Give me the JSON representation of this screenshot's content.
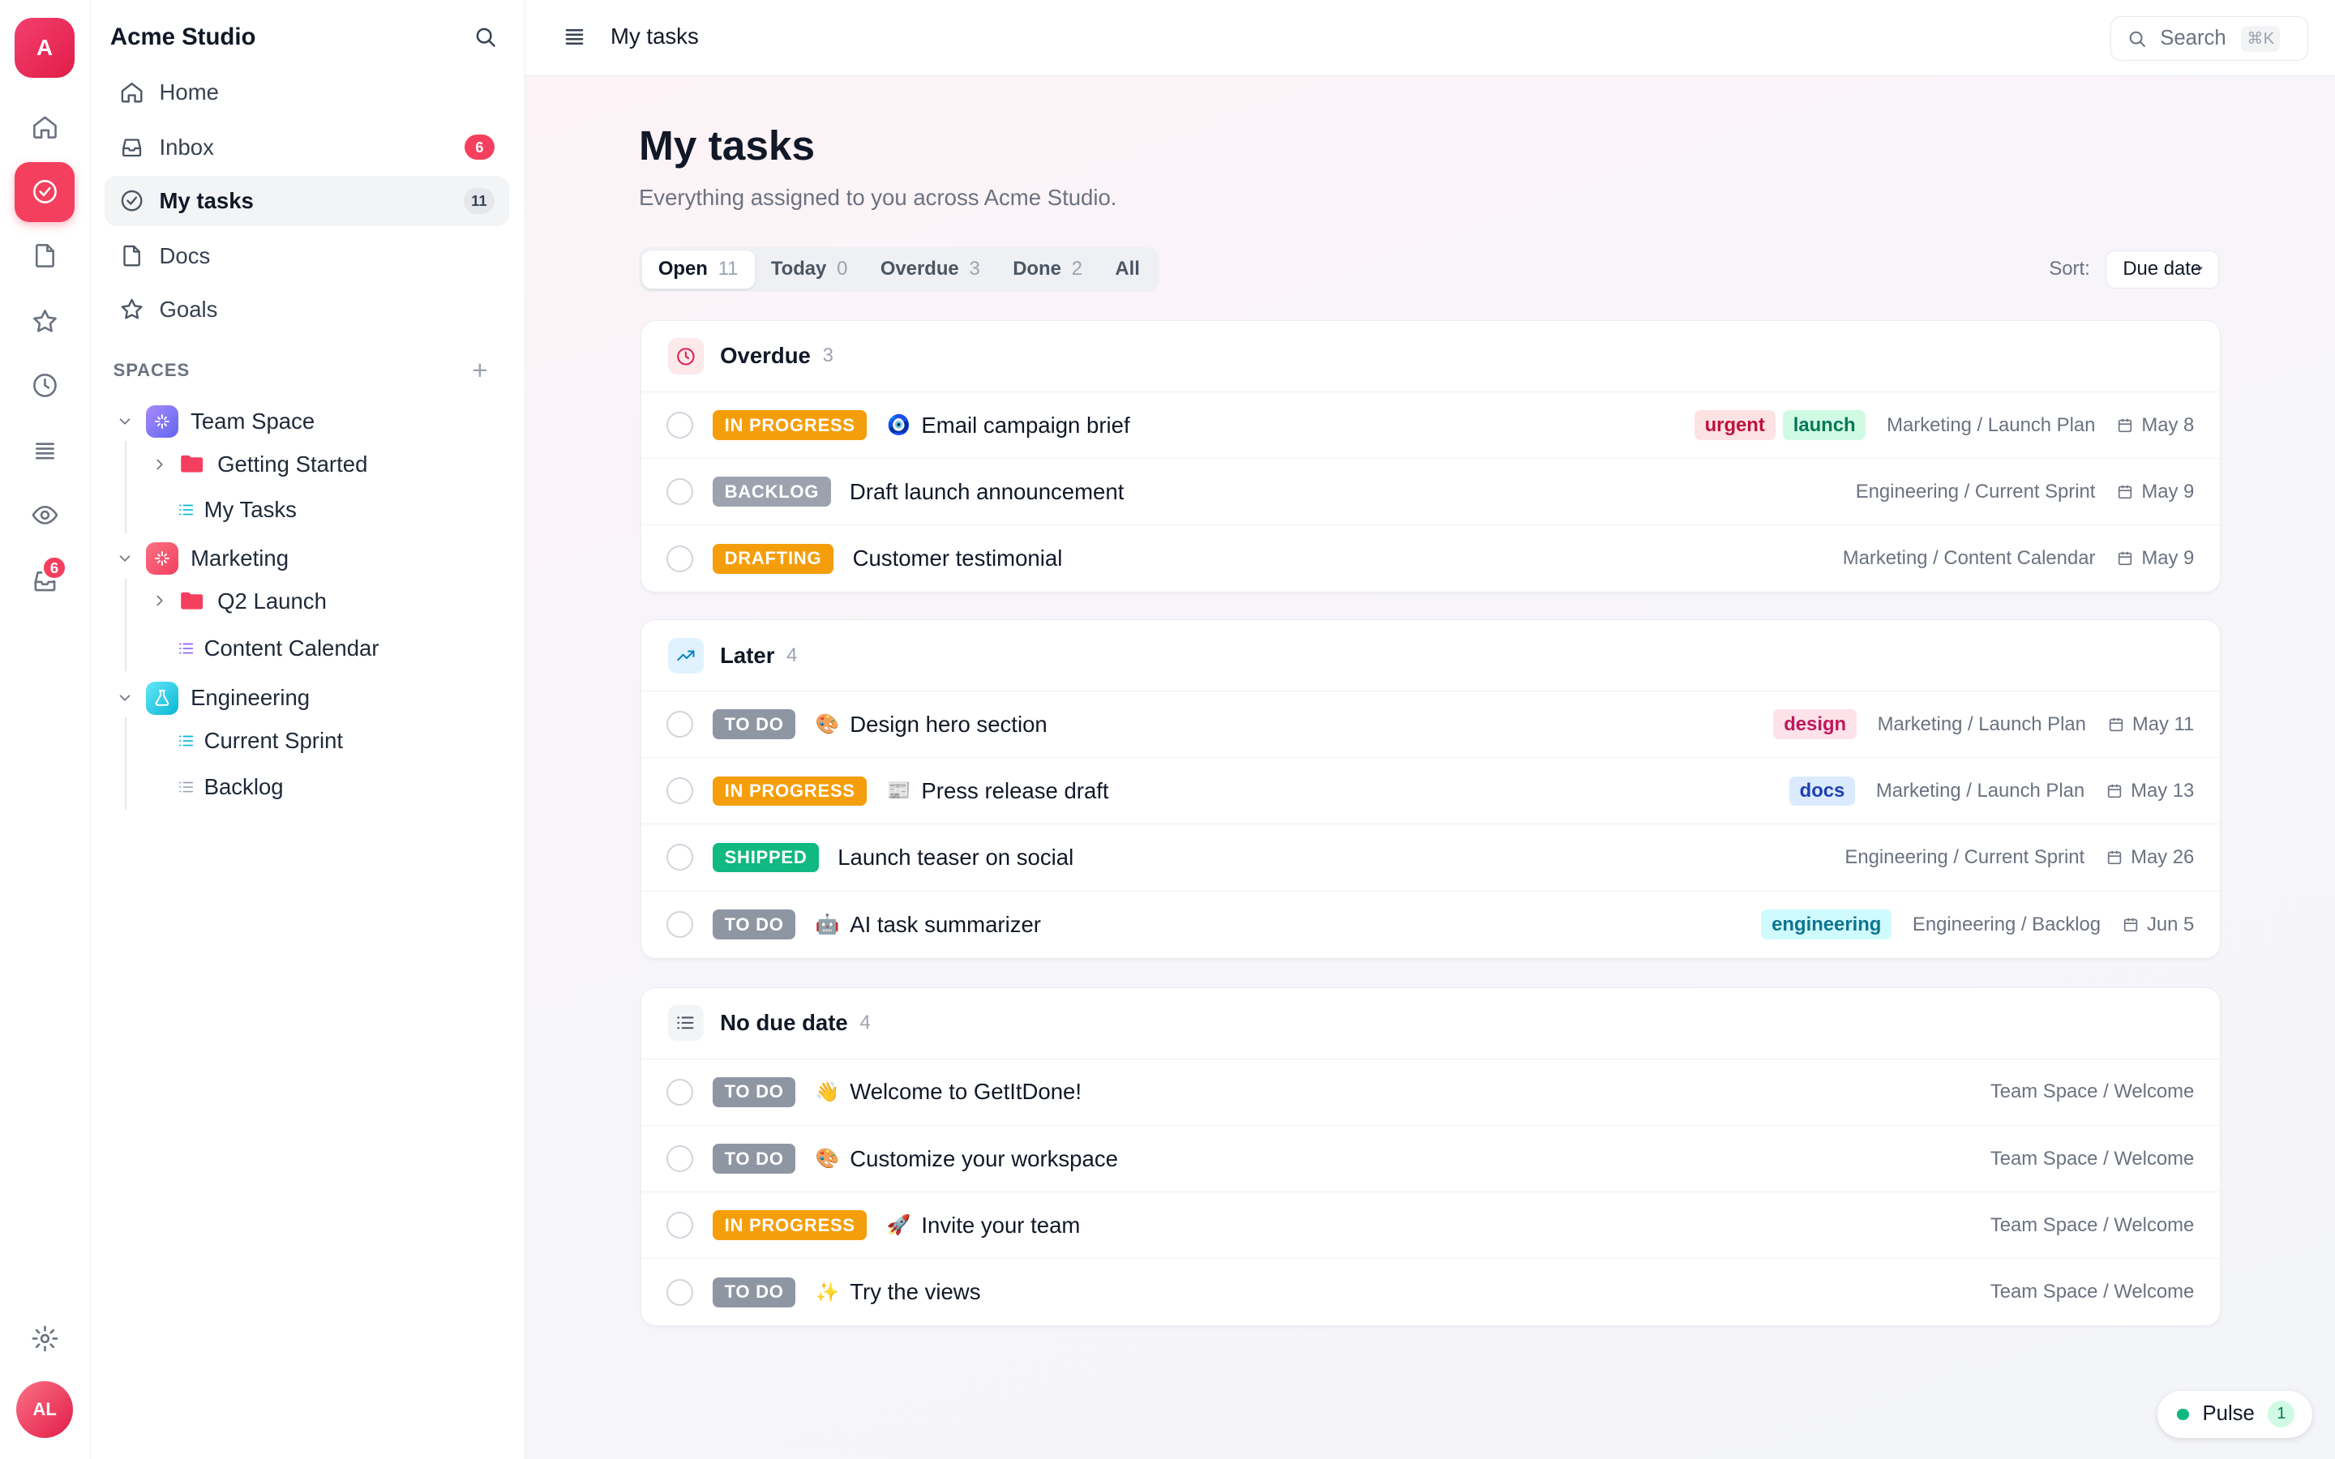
{
  "workspace": {
    "initial": "A",
    "name": "Acme Studio"
  },
  "user": {
    "initials": "AL"
  },
  "rail": {
    "inbox_badge": "6"
  },
  "nav": [
    {
      "label": "Home",
      "icon": "home-icon"
    },
    {
      "label": "Inbox",
      "icon": "inbox-icon",
      "badge": "6"
    },
    {
      "label": "My tasks",
      "icon": "check-circle-icon",
      "badge": "11",
      "active": true
    },
    {
      "label": "Docs",
      "icon": "doc-icon"
    },
    {
      "label": "Goals",
      "icon": "star-icon"
    }
  ],
  "spaces": {
    "heading": "SPACES",
    "team_space": {
      "label": "Team Space",
      "color": "#8b5cf6",
      "children": [
        "Getting Started",
        "My Tasks"
      ]
    },
    "marketing": {
      "label": "Marketing",
      "color": "#f43f5e",
      "children": [
        "Q2 Launch",
        "Content Calendar"
      ]
    },
    "engineering": {
      "label": "Engineering",
      "color": "#22d3ee",
      "children": [
        "Current Sprint",
        "Backlog"
      ]
    }
  },
  "topbar": {
    "title": "My tasks",
    "search_label": "Search",
    "search_kbd": "⌘K"
  },
  "page": {
    "title": "My tasks",
    "subtitle": "Everything assigned to you across Acme Studio."
  },
  "tabs": [
    {
      "label": "Open",
      "count": "11",
      "active": true
    },
    {
      "label": "Today",
      "count": "0"
    },
    {
      "label": "Overdue",
      "count": "3"
    },
    {
      "label": "Done",
      "count": "2"
    },
    {
      "label": "All",
      "count": ""
    }
  ],
  "sort": {
    "label": "Sort:",
    "value": "Due date"
  },
  "status_colors": {
    "IN PROGRESS": "#f59e0b",
    "BACKLOG": "#9ca3af",
    "DRAFTING": "#f59e0b",
    "TO DO": "#8f96a3",
    "SHIPPED": "#10b981"
  },
  "groups": {
    "overdue": {
      "title": "Overdue",
      "count": "3",
      "tasks": [
        {
          "status": "IN PROGRESS",
          "emoji": "🧿",
          "name": "Email campaign brief",
          "tags": [
            "urgent",
            "launch"
          ],
          "path": "Marketing / Launch Plan",
          "due": "May 8"
        },
        {
          "status": "BACKLOG",
          "emoji": "",
          "name": "Draft launch announcement",
          "tags": [],
          "path": "Engineering / Current Sprint",
          "due": "May 9"
        },
        {
          "status": "DRAFTING",
          "emoji": "",
          "name": "Customer testimonial",
          "tags": [],
          "path": "Marketing / Content Calendar",
          "due": "May 9"
        }
      ]
    },
    "later": {
      "title": "Later",
      "count": "4",
      "tasks": [
        {
          "status": "TO DO",
          "emoji": "🎨",
          "name": "Design hero section",
          "tags": [
            "design"
          ],
          "path": "Marketing / Launch Plan",
          "due": "May 11"
        },
        {
          "status": "IN PROGRESS",
          "emoji": "📰",
          "name": "Press release draft",
          "tags": [
            "docs"
          ],
          "path": "Marketing / Launch Plan",
          "due": "May 13"
        },
        {
          "status": "SHIPPED",
          "emoji": "",
          "name": "Launch teaser on social",
          "tags": [],
          "path": "Engineering / Current Sprint",
          "due": "May 26"
        },
        {
          "status": "TO DO",
          "emoji": "🤖",
          "name": "AI task summarizer",
          "tags": [
            "engineering"
          ],
          "path": "Engineering / Backlog",
          "due": "Jun 5"
        }
      ]
    },
    "nodue": {
      "title": "No due date",
      "count": "4",
      "tasks": [
        {
          "status": "TO DO",
          "emoji": "👋",
          "name": "Welcome to GetItDone!",
          "tags": [],
          "path": "Team Space / Welcome",
          "due": ""
        },
        {
          "status": "TO DO",
          "emoji": "🎨",
          "name": "Customize your workspace",
          "tags": [],
          "path": "Team Space / Welcome",
          "due": ""
        },
        {
          "status": "IN PROGRESS",
          "emoji": "🚀",
          "name": "Invite your team",
          "tags": [],
          "path": "Team Space / Welcome",
          "due": ""
        },
        {
          "status": "TO DO",
          "emoji": "✨",
          "name": "Try the views",
          "tags": [],
          "path": "Team Space / Welcome",
          "due": ""
        }
      ]
    }
  },
  "tag_colors": {
    "urgent": {
      "bg": "#fde2e4",
      "fg": "#be123c"
    },
    "launch": {
      "bg": "#d1fae5",
      "fg": "#047857"
    },
    "design": {
      "bg": "#fde2ea",
      "fg": "#be185d"
    },
    "docs": {
      "bg": "#dbeafe",
      "fg": "#1e40af"
    },
    "engineering": {
      "bg": "#cffafe",
      "fg": "#0e7490"
    }
  },
  "pulse": {
    "label": "Pulse",
    "count": "1"
  }
}
